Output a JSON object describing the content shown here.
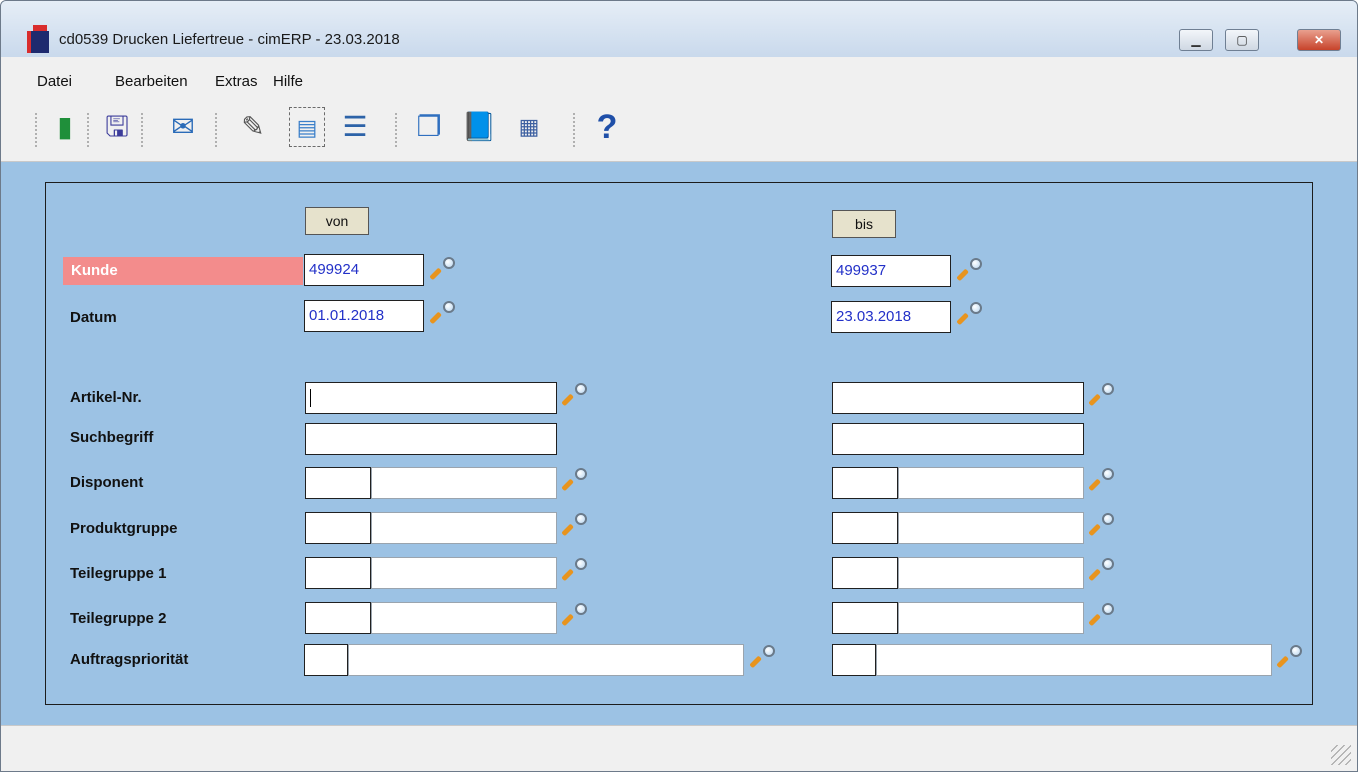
{
  "window": {
    "title": "cd0539 Drucken Liefertreue - cimERP - 23.03.2018"
  },
  "menu": [
    "Datei",
    "Bearbeiten",
    "Extras",
    "Hilfe"
  ],
  "toolbar_icons": [
    "exit-door-icon",
    "save-icon",
    "mail-icon",
    "edit-icon",
    "new-record-icon",
    "transfer-list-icon",
    "windows-icon",
    "book-icon",
    "calculator-icon",
    "help-icon"
  ],
  "columns": {
    "von": "von",
    "bis": "bis"
  },
  "rows": {
    "kunde": {
      "label": "Kunde",
      "von": "499924",
      "bis": "499937"
    },
    "datum": {
      "label": "Datum",
      "von": "01.01.2018",
      "bis": "23.03.2018"
    },
    "artikel": {
      "label": "Artikel-Nr.",
      "von": "",
      "bis": ""
    },
    "suchbegriff": {
      "label": "Suchbegriff",
      "von": "",
      "bis": ""
    },
    "disponent": {
      "label": "Disponent",
      "von": "",
      "von_desc": "",
      "bis": "",
      "bis_desc": ""
    },
    "produktgruppe": {
      "label": "Produktgruppe",
      "von": "",
      "von_desc": "",
      "bis": "",
      "bis_desc": ""
    },
    "teilegruppe1": {
      "label": "Teilegruppe 1",
      "von": "",
      "von_desc": "",
      "bis": "",
      "bis_desc": ""
    },
    "teilegruppe2": {
      "label": "Teilegruppe 2",
      "von": "",
      "von_desc": "",
      "bis": "",
      "bis_desc": ""
    },
    "auftragsprioritaet": {
      "label": "Auftragspriorität",
      "von": "",
      "von_desc": "",
      "bis": "",
      "bis_desc": ""
    }
  },
  "colors": {
    "highlight": "#f38c8c",
    "panel_bg": "#9cc2e4",
    "value_text": "#2230c8"
  }
}
